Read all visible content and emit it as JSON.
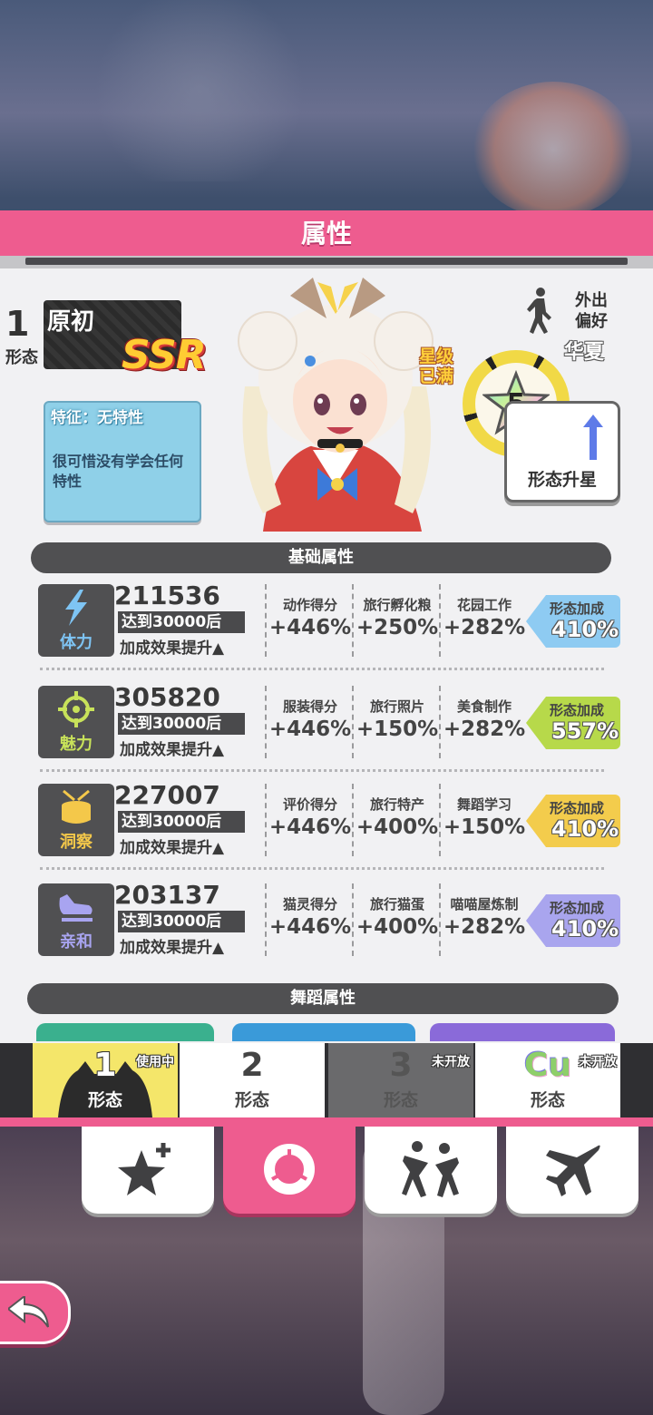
{
  "screen_title": "属性",
  "character": {
    "form_number": "1",
    "form_label": "形态",
    "name": "原初",
    "rarity": "SSR",
    "star_status": "星级已满",
    "outing_pref_label": "外出偏好",
    "outing_pref_value": "华夏",
    "star_level": "5",
    "upgrade_label": "形态升星"
  },
  "trait": {
    "title": "特征：无特性",
    "description": "很可惜没有学会任何特性"
  },
  "sections": {
    "basic": "基础属性",
    "dance": "舞蹈属性"
  },
  "stats": [
    {
      "name": "体力",
      "icon": "lightning-icon",
      "value": "211536",
      "reach": "达到30000后",
      "boost": "加成效果提升▲",
      "bonuses": [
        {
          "name": "动作得分",
          "value": "+446%"
        },
        {
          "name": "旅行孵化粮",
          "value": "+250%"
        },
        {
          "name": "花园工作",
          "value": "+282%"
        }
      ],
      "form_bonus_label": "形态加成",
      "form_bonus_value": "410%",
      "color": "#8ecbf2",
      "icon_color": "#7ec4f4"
    },
    {
      "name": "魅力",
      "icon": "crosshair-icon",
      "value": "305820",
      "reach": "达到30000后",
      "boost": "加成效果提升▲",
      "bonuses": [
        {
          "name": "服装得分",
          "value": "+446%"
        },
        {
          "name": "旅行照片",
          "value": "+150%"
        },
        {
          "name": "美食制作",
          "value": "+282%"
        }
      ],
      "form_bonus_label": "形态加成",
      "form_bonus_value": "557%",
      "color": "#b7d94a",
      "icon_color": "#c8e25a"
    },
    {
      "name": "洞察",
      "icon": "drum-icon",
      "value": "227007",
      "reach": "达到30000后",
      "boost": "加成效果提升▲",
      "bonuses": [
        {
          "name": "评价得分",
          "value": "+446%"
        },
        {
          "name": "旅行特产",
          "value": "+400%"
        },
        {
          "name": "舞蹈学习",
          "value": "+150%"
        }
      ],
      "form_bonus_label": "形态加成",
      "form_bonus_value": "410%",
      "color": "#f3cc4c",
      "icon_color": "#f4c84a"
    },
    {
      "name": "亲和",
      "icon": "shoe-icon",
      "value": "203137",
      "reach": "达到30000后",
      "boost": "加成效果提升▲",
      "bonuses": [
        {
          "name": "猫灵得分",
          "value": "+446%"
        },
        {
          "name": "旅行猫蛋",
          "value": "+400%"
        },
        {
          "name": "喵喵屋炼制",
          "value": "+282%"
        }
      ],
      "form_bonus_label": "形态加成",
      "form_bonus_value": "410%",
      "color": "#a9a5ee",
      "icon_color": "#a8a4f0"
    }
  ],
  "form_tabs": [
    {
      "num": "1",
      "label": "形态",
      "badge": "使用中"
    },
    {
      "num": "2",
      "label": "形态",
      "badge": ""
    },
    {
      "num": "3",
      "label": "形态",
      "badge": "未开放"
    },
    {
      "num": "Cu",
      "label": "形态",
      "badge": "未开放"
    }
  ],
  "bottom_nav": [
    "star-plus-icon",
    "donut-icon",
    "dancers-icon",
    "airplane-icon"
  ],
  "colors": {
    "accent": "#ee5c8f",
    "panel": "#f1f1f3",
    "dark": "#505052"
  }
}
